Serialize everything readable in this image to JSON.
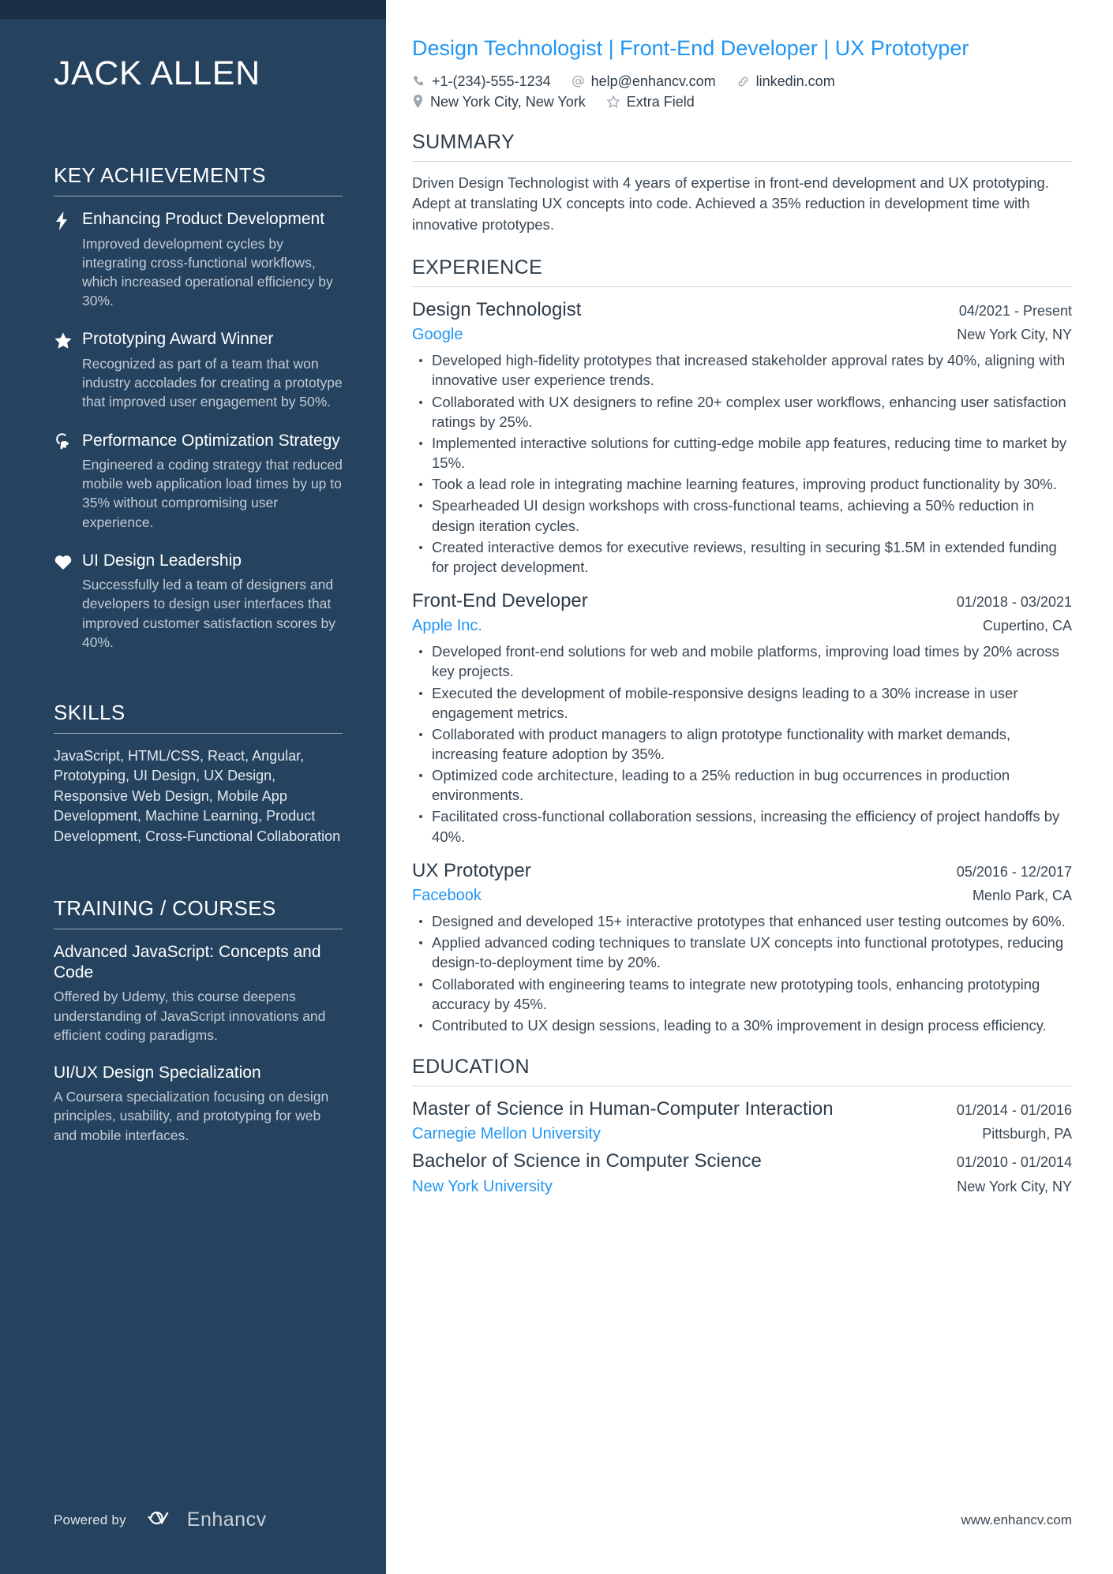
{
  "theme": {
    "sidebar_bg": "#25425f",
    "sidebar_strip": "#1b2f44",
    "accent_blue": "#2196f3",
    "body_text": "#3a4752"
  },
  "sidebar": {
    "name": "JACK ALLEN",
    "achievements": {
      "heading": "KEY ACHIEVEMENTS",
      "items": [
        {
          "icon": "lightning-bolt-icon",
          "title": "Enhancing Product Development",
          "description": "Improved development cycles by integrating cross-functional workflows, which increased operational efficiency by 30%."
        },
        {
          "icon": "star-icon",
          "title": "Prototyping Award Winner",
          "description": "Recognized as part of a team that won industry accolades for creating a prototype that improved user engagement by 50%."
        },
        {
          "icon": "head-idea-icon",
          "title": "Performance Optimization Strategy",
          "description": "Engineered a coding strategy that reduced mobile web application load times by up to 35% without compromising user experience."
        },
        {
          "icon": "heart-icon",
          "title": "UI Design Leadership",
          "description": "Successfully led a team of designers and developers to design user interfaces that improved customer satisfaction scores by 40%."
        }
      ]
    },
    "skills": {
      "heading": "SKILLS",
      "text": "JavaScript, HTML/CSS, React, Angular, Prototyping, UI Design, UX Design, Responsive Web Design, Mobile App Development, Machine Learning, Product Development, Cross-Functional Collaboration"
    },
    "training": {
      "heading": "TRAINING / COURSES",
      "items": [
        {
          "title": "Advanced JavaScript: Concepts and Code",
          "description": "Offered by Udemy, this course deepens understanding of JavaScript innovations and efficient coding paradigms."
        },
        {
          "title": "UI/UX Design Specialization",
          "description": "A Coursera specialization focusing on design principles, usability, and prototyping for web and mobile interfaces."
        }
      ]
    },
    "footer": {
      "powered_by": "Powered by",
      "brand": "Enhancv",
      "brand_icon": "enhancv-logo-icon"
    }
  },
  "main": {
    "headline": "Design Technologist | Front-End Developer | UX Prototyper",
    "contacts": {
      "row1": [
        {
          "icon": "phone-icon",
          "text": "+1-(234)-555-1234"
        },
        {
          "icon": "email-at-icon",
          "text": "help@enhancv.com"
        },
        {
          "icon": "link-icon",
          "text": "linkedin.com"
        }
      ],
      "row2": [
        {
          "icon": "location-pin-icon",
          "text": "New York City, New York"
        },
        {
          "icon": "star-outline-icon",
          "text": "Extra Field"
        }
      ]
    },
    "summary": {
      "heading": "SUMMARY",
      "text": "Driven Design Technologist with 4 years of expertise in front-end development and UX prototyping. Adept at translating UX concepts into code. Achieved a 35% reduction in development time with innovative prototypes."
    },
    "experience": {
      "heading": "EXPERIENCE",
      "jobs": [
        {
          "title": "Design Technologist",
          "date": "04/2021 - Present",
          "company": "Google",
          "location": "New York City, NY",
          "bullets": [
            "Developed high-fidelity prototypes that increased stakeholder approval rates by 40%, aligning with innovative user experience trends.",
            "Collaborated with UX designers to refine 20+ complex user workflows, enhancing user satisfaction ratings by 25%.",
            "Implemented interactive solutions for cutting-edge mobile app features, reducing time to market by 15%.",
            "Took a lead role in integrating machine learning features, improving product functionality by 30%.",
            "Spearheaded UI design workshops with cross-functional teams, achieving a 50% reduction in design iteration cycles.",
            "Created interactive demos for executive reviews, resulting in securing $1.5M in extended funding for project development."
          ]
        },
        {
          "title": "Front-End Developer",
          "date": "01/2018 - 03/2021",
          "company": "Apple Inc.",
          "location": "Cupertino, CA",
          "bullets": [
            "Developed front-end solutions for web and mobile platforms, improving load times by 20% across key projects.",
            "Executed the development of mobile-responsive designs leading to a 30% increase in user engagement metrics.",
            "Collaborated with product managers to align prototype functionality with market demands, increasing feature adoption by 35%.",
            "Optimized code architecture, leading to a 25% reduction in bug occurrences in production environments.",
            "Facilitated cross-functional collaboration sessions, increasing the efficiency of project handoffs by 40%."
          ]
        },
        {
          "title": "UX Prototyper",
          "date": "05/2016 - 12/2017",
          "company": "Facebook",
          "location": "Menlo Park, CA",
          "bullets": [
            "Designed and developed 15+ interactive prototypes that enhanced user testing outcomes by 60%.",
            "Applied advanced coding techniques to translate UX concepts into functional prototypes, reducing design-to-deployment time by 20%.",
            "Collaborated with engineering teams to integrate new prototyping tools, enhancing prototyping accuracy by 45%.",
            "Contributed to UX design sessions, leading to a 30% improvement in design process efficiency."
          ]
        }
      ]
    },
    "education": {
      "heading": "EDUCATION",
      "items": [
        {
          "degree": "Master of Science in Human-Computer Interaction",
          "date": "01/2014 - 01/2016",
          "school": "Carnegie Mellon University",
          "location": "Pittsburgh, PA"
        },
        {
          "degree": "Bachelor of Science in Computer Science",
          "date": "01/2010 - 01/2014",
          "school": "New York University",
          "location": "New York City, NY"
        }
      ]
    },
    "footer_url": "www.enhancv.com"
  }
}
